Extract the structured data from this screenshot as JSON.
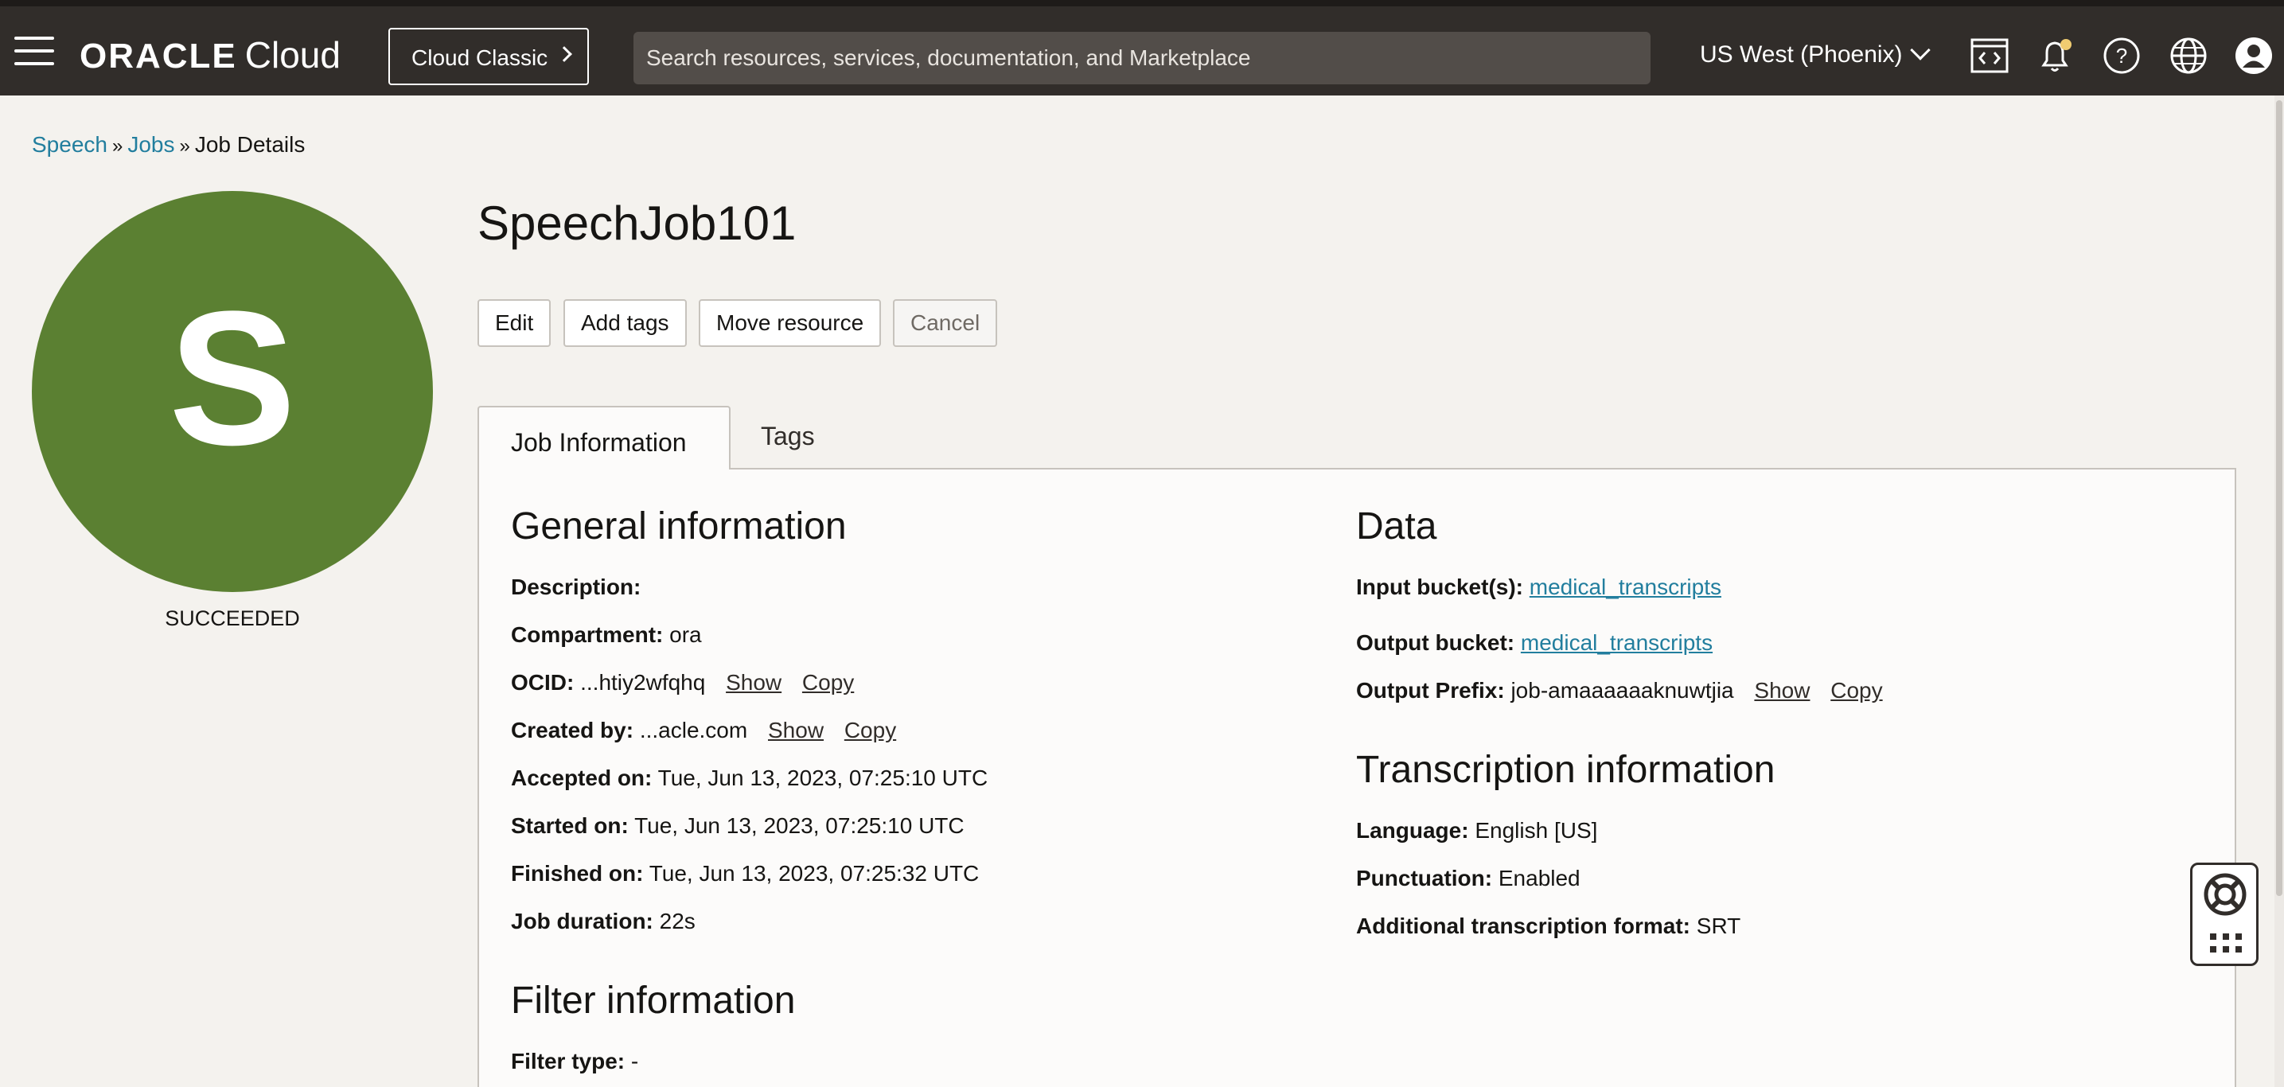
{
  "header": {
    "logo_brand": "ORACLE",
    "logo_product": "Cloud",
    "classic_label": "Cloud Classic",
    "search_placeholder": "Search resources, services, documentation, and Marketplace",
    "region": "US West (Phoenix)"
  },
  "breadcrumb": {
    "items": [
      "Speech",
      "Jobs",
      "Job Details"
    ],
    "separator": "»"
  },
  "avatar": {
    "letter": "S",
    "color": "#5b8032",
    "status": "SUCCEEDED"
  },
  "title": "SpeechJob101",
  "actions": [
    "Edit",
    "Add tags",
    "Move resource",
    "Cancel"
  ],
  "tabs": [
    "Job Information",
    "Tags"
  ],
  "general": {
    "heading": "General information",
    "description_label": "Description:",
    "compartment_label": "Compartment:",
    "compartment_value": "ora",
    "ocid_label": "OCID:",
    "ocid_value": "...htiy2wfqhq",
    "created_label": "Created by:",
    "created_value": "...acle.com",
    "show": "Show",
    "copy": "Copy",
    "accepted_label": "Accepted on:",
    "accepted_value": "Tue, Jun 13, 2023, 07:25:10 UTC",
    "started_label": "Started on:",
    "started_value": "Tue, Jun 13, 2023, 07:25:10 UTC",
    "finished_label": "Finished on:",
    "finished_value": "Tue, Jun 13, 2023, 07:25:32 UTC",
    "duration_label": "Job duration:",
    "duration_value": "22s"
  },
  "filter": {
    "heading": "Filter information",
    "type_label": "Filter type:",
    "type_value": "-"
  },
  "data": {
    "heading": "Data",
    "input_label": "Input bucket(s):",
    "input_value": "medical_transcripts",
    "output_label": "Output bucket:",
    "output_value": "medical_transcripts",
    "prefix_label": "Output Prefix:",
    "prefix_value": "job-amaaaaaaknuwtjia"
  },
  "transcription": {
    "heading": "Transcription information",
    "language_label": "Language:",
    "language_value": "English [US]",
    "punctuation_label": "Punctuation:",
    "punctuation_value": "Enabled",
    "format_label": "Additional transcription format:",
    "format_value": "SRT"
  },
  "colors": {
    "topbar": "#312d2a",
    "link": "#227e9e",
    "avatar": "#5b8032",
    "notification_dot": "#f0cc71"
  },
  "icons": [
    "hamburger-icon",
    "chevron-right-icon",
    "chevron-down-icon",
    "code-editor-icon",
    "bell-icon",
    "help-icon",
    "globe-icon",
    "user-icon",
    "lifebuoy-icon",
    "grid-icon"
  ]
}
